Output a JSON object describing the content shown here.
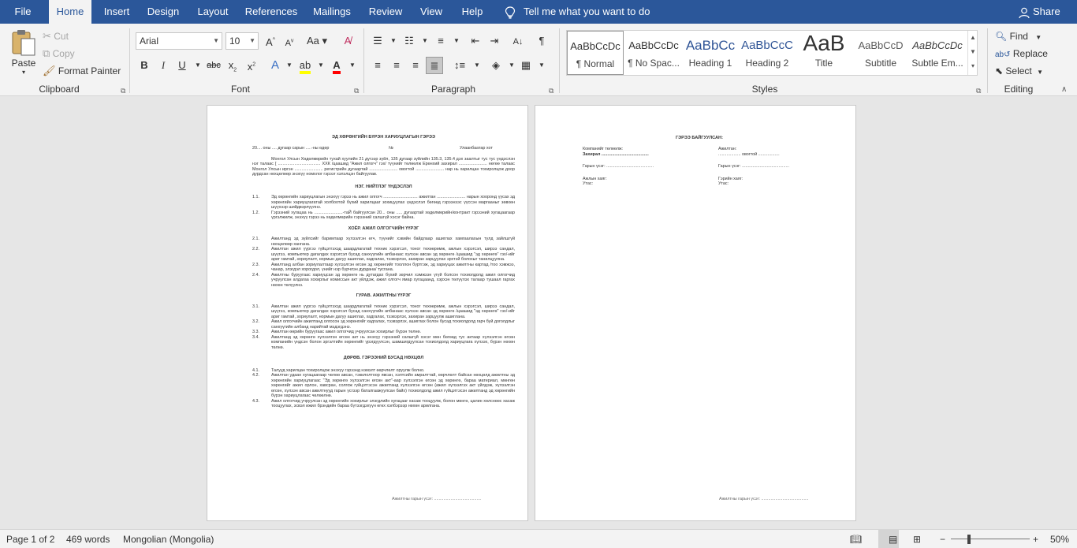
{
  "tabs": [
    "File",
    "Home",
    "Insert",
    "Design",
    "Layout",
    "References",
    "Mailings",
    "Review",
    "View",
    "Help"
  ],
  "active_tab": "Home",
  "tell_me": "Tell me what you want to do",
  "share": "Share",
  "clipboard": {
    "paste": "Paste",
    "cut": "Cut",
    "copy": "Copy",
    "format_painter": "Format Painter",
    "label": "Clipboard"
  },
  "font": {
    "name": "Arial",
    "size": "10",
    "label": "Font"
  },
  "paragraph": {
    "label": "Paragraph"
  },
  "styles": {
    "label": "Styles",
    "items": [
      {
        "sample": "AaBbCcDc",
        "name": "¶ Normal"
      },
      {
        "sample": "AaBbCcDc",
        "name": "¶ No Spac..."
      },
      {
        "sample": "AaBbCc",
        "name": "Heading 1"
      },
      {
        "sample": "AaBbCcC",
        "name": "Heading 2"
      },
      {
        "sample": "AaB",
        "name": "Title"
      },
      {
        "sample": "AaBbCcD",
        "name": "Subtitle"
      },
      {
        "sample": "AaBbCcDc",
        "name": "Subtle Em..."
      }
    ]
  },
  "editing": {
    "find": "Find",
    "replace": "Replace",
    "select": "Select",
    "label": "Editing"
  },
  "colors": {
    "accent": "#2b579a",
    "highlight": "#ffff00",
    "font_color": "#ff0000"
  },
  "page1": {
    "title": "ЭД ХӨРӨНГИЙН БҮРЭН ХАРИУЦЛАГЫН ГЭРЭЭ",
    "date_line": "20.... оны .... дугаар сарын .....-ны өдөр",
    "num": "№",
    "city": "Улаанбаатар хот",
    "intro": "Монгол Улсын Хөдөлмөрийн тухай хуулийн 21 дүгээр зүйл, 135 дугаар зүйлийн 135.3, 135.4 дэх заалтыг тус тус үндэслэн нэг талаас [ .................................... ХХК /цаашид \"Ажил олгогч\" гэх/ түүнийг төлөөлж Ерөнхий захирал ........................ нөгөө талаас Монгол Улсын иргэн ........................ регистрийн дугаартай ........................ овогтой ........................ нар нь харилцан тохиролцож доор дурдсан нөхцөлөөр энэхүү номхлог гэрээг хэлэлцэн байгуулав.",
    "s1": "НЭГ. НИЙТЛЭГ ҮНДЭСЛЭЛ",
    "s1_items": [
      {
        "n": "1.1.",
        "t": "Эд хөрөнгийн хариуцлагын энэхүү гэрээ нь ажил олгогч ............................. ажилтан ........................ нарын хооронд үүсах эд хөрөнгийн хариуцлагатай холбоотой бүхий харилцааг зохицуулах үндэслэл бөгөөд гэрээнээс үүссэн маргааныг зөвхөн шүүхээр шийдвэрлүүлнэ."
      },
      {
        "n": "1.2.",
        "t": "Гэрээний хугацаа нь ........................-таЙ байгуулсан 20... оны ..... дугаартай хөдөлмөрийн/контракт гэрээний хугацаагаар үргэлжилж, энэхүү гэрээ нь хөдөлмөрийн гэрээний салшгүй хэсэг байна."
      }
    ],
    "s2": "ХОЁР. АЖИЛ ОЛГОГЧИЙН ҮҮРЭГ",
    "s2_items": [
      {
        "n": "2.1.",
        "t": "Ажилтанд эд зүйлсийг баримтаар хүлээлгэн өгч, түүнийг хэвийн байдлаар ашиглах хамгаалахын тулд зайлшгүй нөхцөлөөр хангана."
      },
      {
        "n": "2.2.",
        "t": "Ажилтан ажил үүргээ гүйцэтгэхэд шаардлагатай техник хэрэгсэл, тоног төхөөрөмж, ажлын хэрэгсэл, ширээ сандал, шүүгээ, компьютер дагалдах хэрэгсэл бусад санхүүгийн апбанаас хүлээн авсан эд хөрөнгө /цаашид \"эд хөрөнгө\" гэх/-ийг ариг гамтай, зориулалт, нормын дагуу ашиглах, хадгалах, тээвэрлэх, захиран зарцуулах эрхтэй болохыг танилцуулна."
      },
      {
        "n": "2.3.",
        "t": "Ажилтанд албан зориулалтаар хүлээлгэн өгсөн эд хөрөнгийг тооллон бүртгэж, эд хариуцах ажилтны картад /тоо хэмжээ, чанар, элэгдэл хорогдол, үнийг нэр бүрчлэн дурдана/ тусгана."
      },
      {
        "n": "2.4.",
        "t": "Ажилтны буруугаас хариуцсан эд хөрөнгө нь дутагдах бүхий зөрчил хэмжээн үгүй болсон тохиолдолд ажил олгогчид учруулсан алдагаа хохирлыг комиссын акт үйлдэж, ажил олгогч ямар хугацаанд, хэрхэн төлүүлэх талаар тушаал гаргах нөхөн төлүүлнэ."
      }
    ],
    "s3": "ГУРАВ. АЖИЛТНЫ ҮҮРЭГ",
    "s3_items": [
      {
        "n": "3.1.",
        "t": "Ажилтан ажил үүргээ гүйцэтгэхэд шаардлагатай техник хэрэгсэл, тоног төхөөрөмж, ажлын хэрэгсэл, ширээ сандал, шүүгээ, компьютер дагалдах хэрэгсэл бусад санхүүгийн апбанаас хүлээн авсан эд хөрөнгө /цаашид \"эд хөрөнгө\" гэх/-ийг ариг гамтай, зориулалт, нормын дагуу ашиглах, хадгалах, тээвэрлэх, захиран зарцуулж ашиглана."
      },
      {
        "n": "3.2.",
        "t": "Ажил олгогчийн ажилтанд олгосон эд хөрөнгийг хадгалах, тээвэрлэх, ашиглах болон бусад тохиолдолд гарч буй доголдлыг санхүүгийн албанд нарийтай мэдэгдэнэ."
      },
      {
        "n": "3.3.",
        "t": "Ажилтан өөрийн буруугаас ажил олгогчид учруулсан хохирлыг бүрэн төлнө."
      },
      {
        "n": "3.4.",
        "t": "Ажилтанд эд хөрөнгө хүлээлгэн өгсөн акт нь энэхүү гэрээний салшгүй хэсэг мөн бөгөөд тус актаар хүлээлгэн өгсөн компанийн үндсэн болон эргэлтийн хөрөнгийг үрэгдүүлсэн, шамшигдуулсан тохиолдолд хариуцлага хүлээх, бүрэн нөхөн төлнө."
      }
    ],
    "s4": "ДӨРӨВ. ГЭРЭЭНИЙ БУСАД НӨХЦӨЛ",
    "s4_items": [
      {
        "n": "4.1.",
        "t": "Талууд харилцан тохиролцож энэхүү гэрээнд нэмэлт өөрчлөлт оруулж болно."
      },
      {
        "n": "4.2.",
        "t": "Ажилтан удаан хугацаагаар чөлөө авсан, тэкилолтоор явсан, хэлтсийн амралттай, өөрчлөлт байсан нөхцөлд ажилтны эд хөрөнгийн хариуцлагаас \"Эд хөрөнгө хүлээлгэн өгсөн акт\"-аар хүлээлгэн өгсөн эд хөрөнгө, бараа материал, мөнгөн хөрөнгийг ажил орлон, хавсран, солгож гүйцэтгэсэн ажилтанд хүлээлгэн өгсөн (ажил хүлээлгэх акт үйлдэж, хүлээлгэн өгсөн, хүлээн авсан ажилтнууд гарын үсгээр баталгаажуулсан байх) тохиолдолд ажил гүйцэтгэсэн ажилтанд эд хөрөнгийн бүрэн хариуцлагаас чөлөөлнө."
      },
      {
        "n": "4.3.",
        "t": "Ажил олгогчид учруулсан эд хөрөнгийн хохирлыг элэгдлийн хугацааг хасаж тооцуулж, болон мөнгө, цалин хөлснөөс хасаж тооцуулах, эсвэл ижил брэндийн бараа бүтээгдэхүүн өгөх хэлбэрээр нөхөн арилгана."
      }
    ],
    "footer": "Ажилтны гарын үсэг: ........................................"
  },
  "page2": {
    "title": "ГЭРЭЭ БАЙГУУЛСАН:",
    "left": {
      "company": "Компанийг төлөөлж:",
      "director": "Захирал ........................................",
      "sign": "Гарын үсэг: ........................................",
      "address": "Ажлын хаяг:",
      "phone": "Утас:"
    },
    "right": {
      "employee": "Ажилтан:",
      "name_line": "................... овогтой ..................",
      "sign": "Гарын үсэг: ........................................",
      "address": "Гэрийн хаяг:",
      "phone": "Утас:"
    },
    "footer": "Ажилтны гарын үсэг: ........................................"
  },
  "status": {
    "page": "Page 1 of 2",
    "words": "469 words",
    "language": "Mongolian (Mongolia)",
    "zoom": "50%"
  }
}
